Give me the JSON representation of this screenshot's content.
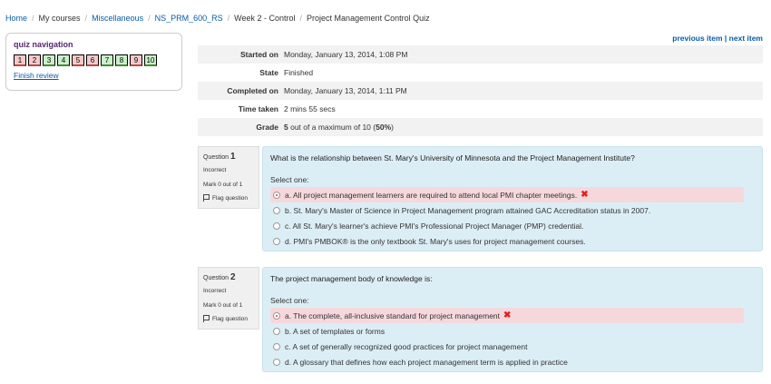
{
  "breadcrumb": {
    "home": "Home",
    "mycourses": "My courses",
    "misc": "Miscellaneous",
    "course": "NS_PRM_600_RS",
    "week": "Week 2 - Control",
    "current": "Project Management Control Quiz"
  },
  "quiznav": {
    "title": "quiz navigation",
    "buttons": [
      "1",
      "2",
      "3",
      "4",
      "5",
      "6",
      "7",
      "8",
      "9",
      "10"
    ],
    "finish": "Finish review"
  },
  "nav": {
    "previous": "previous item",
    "sep": "|",
    "next": "next item"
  },
  "summary": {
    "started_label": "Started on",
    "started_value": "Monday, January 13, 2014, 1:08 PM",
    "state_label": "State",
    "state_value": "Finished",
    "completed_label": "Completed on",
    "completed_value": "Monday, January 13, 2014, 1:11 PM",
    "time_label": "Time taken",
    "time_value": "2 mins 55 secs",
    "grade_label": "Grade",
    "grade_score": "5",
    "grade_mid": " out of a maximum of 10 (",
    "grade_pct": "50%",
    "grade_end": ")"
  },
  "questions": [
    {
      "qlabel": "Question",
      "qnum": "1",
      "state": "Incorrect",
      "mark": "Mark 0 out of 1",
      "flag": "Flag question",
      "text": "What is the relationship between St. Mary's University of Minnesota and the Project Management Institute?",
      "prompt": "Select one:",
      "answers": [
        "a. All project management learners are required to attend local PMI chapter meetings.",
        "b. St. Mary's Master of Science in Project Management program attained GAC Accreditation status in 2007.",
        "c. All St. Mary's learner's achieve PMI's Professional Project Manager (PMP) credential.",
        "d. PMI's PMBOK® is the only textbook St. Mary's uses for project management courses."
      ]
    },
    {
      "qlabel": "Question",
      "qnum": "2",
      "state": "Incorrect",
      "mark": "Mark 0 out of 1",
      "flag": "Flag question",
      "text": "The project management body of knowledge is:",
      "prompt": "Select one:",
      "answers": [
        "a. The complete, all-inclusive standard for project management",
        "b. A set of templates or forms",
        "c. A set of generally recognized good practices for project management",
        "d. A glossary that defines how each project management term is applied in practice"
      ]
    }
  ],
  "colors": {
    "link": "#0a5ba8",
    "nav_title": "#552770",
    "incorrect_bg": "#f6d8dc",
    "question_bg": "#dceef5"
  },
  "icons": {
    "flag": "flag-icon",
    "wrong": "cross-icon"
  }
}
